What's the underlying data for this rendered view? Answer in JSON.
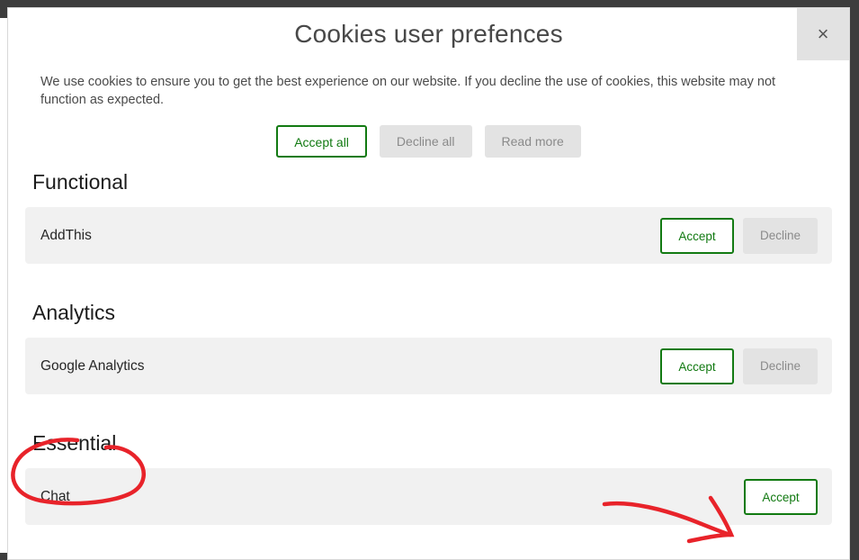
{
  "dialog": {
    "title": "Cookies user prefences",
    "close_label": "×",
    "close_icon": "close-icon",
    "intro": "We use cookies to ensure you to get the best experience on our website. If you decline the use of cookies, this website may not function as expected.",
    "top_actions": [
      {
        "label": "Accept all",
        "style": "accept"
      },
      {
        "label": "Decline all",
        "style": "muted"
      },
      {
        "label": "Read more",
        "style": "muted"
      }
    ]
  },
  "sections": [
    {
      "title": "Functional",
      "rows": [
        {
          "label": "AddThis",
          "accept_label": "Accept",
          "decline_label": "Decline"
        }
      ]
    },
    {
      "title": "Analytics",
      "rows": [
        {
          "label": "Google Analytics",
          "accept_label": "Accept",
          "decline_label": "Decline"
        }
      ]
    },
    {
      "title": "Essential",
      "rows": [
        {
          "label": "Chat",
          "accept_label": "Accept",
          "decline_label": ""
        }
      ]
    }
  ],
  "colors": {
    "accent_green": "#127a12",
    "muted_button_bg": "#e3e3e3",
    "muted_button_text": "#8a8a8a",
    "row_bg": "#f1f1f1",
    "annotation_red": "#e8232a",
    "title_text": "#484848",
    "backdrop": "#3d3d3d"
  },
  "annotations": [
    {
      "kind": "circle",
      "target": "Essential",
      "color": "#e8232a"
    },
    {
      "kind": "arrow",
      "target": "Accept",
      "color": "#e8232a"
    }
  ]
}
